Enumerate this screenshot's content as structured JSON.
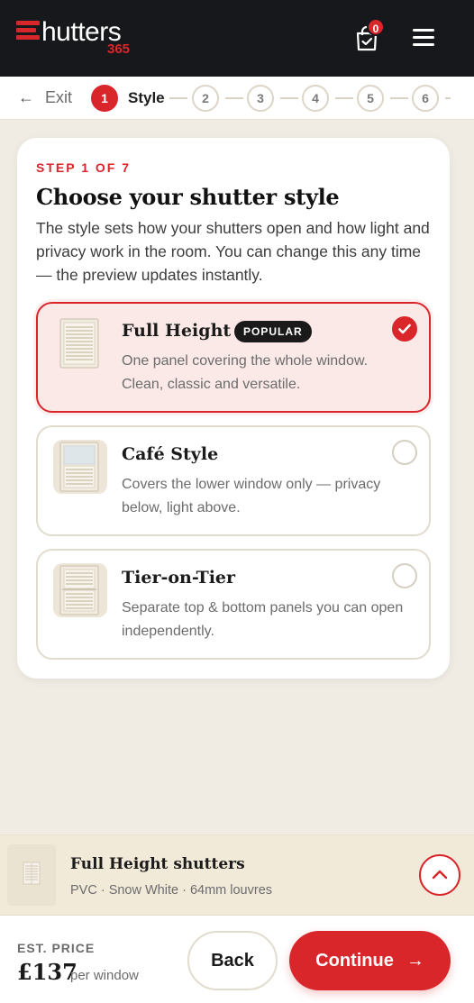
{
  "header": {
    "logo_text": "hutters",
    "logo_sub": "365",
    "cart_count": "0",
    "brand_color": "#d9262b"
  },
  "stepper": {
    "exit_label": "Exit",
    "active_step": "1",
    "active_label": "Style",
    "steps": [
      "2",
      "3",
      "4",
      "5",
      "6"
    ]
  },
  "card": {
    "step_label": "STEP 1 OF 7",
    "title": "Choose your shutter style",
    "description": "The style sets how your shutters open and how light and privacy work in the room. You can change this any time — the preview updates instantly.",
    "options": [
      {
        "name": "Full Height",
        "badge": "POPULAR",
        "description": "One panel covering the whole window. Clean, classic and versatile.",
        "selected": true
      },
      {
        "name": "Café Style",
        "badge": "",
        "description": "Covers the lower window only — privacy below, light above.",
        "selected": false
      },
      {
        "name": "Tier-on-Tier",
        "badge": "",
        "description": "Separate top & bottom panels you can open independently.",
        "selected": false
      }
    ]
  },
  "summary": {
    "title": "Full Height shutters",
    "subtitle": "PVC · Snow White · 64mm louvres"
  },
  "footer": {
    "price_label": "EST. PRICE",
    "price_value": "£137",
    "price_unit": "per window",
    "back_label": "Back",
    "continue_label": "Continue"
  }
}
